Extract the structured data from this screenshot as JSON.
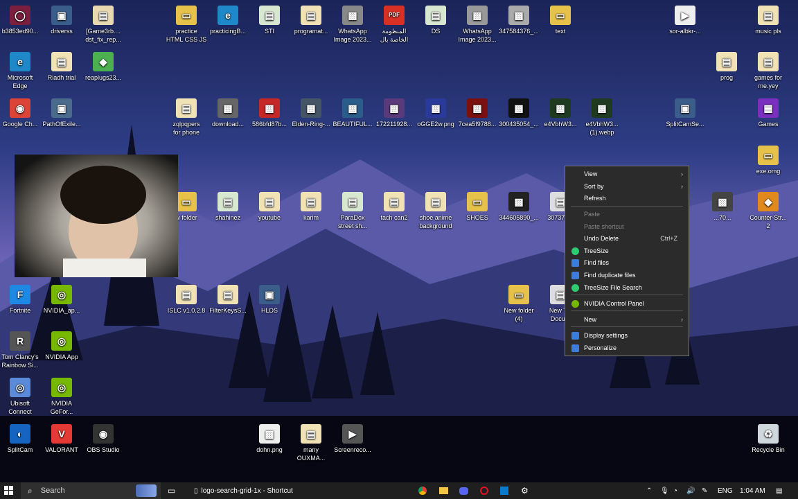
{
  "desktop": {
    "icons": [
      {
        "label": "b3853ed90...",
        "color": "#7a1f3d",
        "glyph": "◯"
      },
      {
        "label": "driverss",
        "color": "#3b5d8a",
        "glyph": "▣"
      },
      {
        "label": "[Game3rb....\ndst_fix_rep...",
        "color": "#e8d9b0",
        "glyph": "▤"
      },
      {
        "label": "practice\nHTML CSS JS",
        "color": "#e7c24a",
        "glyph": "▭"
      },
      {
        "label": "practicingB...",
        "color": "#1e88c9",
        "glyph": "e"
      },
      {
        "label": "STI",
        "color": "#d8e8d0",
        "glyph": "▤"
      },
      {
        "label": "programat...",
        "color": "#f0e2b5",
        "glyph": "▤"
      },
      {
        "label": "WhatsApp\nImage 2023...",
        "color": "#888888",
        "glyph": "▩"
      },
      {
        "label": "المنظومة\nالخاصة بال",
        "color": "#d93025",
        "glyph": "PDF"
      },
      {
        "label": "DS",
        "color": "#d8e8d0",
        "glyph": "▤"
      },
      {
        "label": "WhatsApp\nImage 2023...",
        "color": "#999999",
        "glyph": "▩"
      },
      {
        "label": "347584376_...",
        "color": "#aaaaaa",
        "glyph": "▩"
      },
      {
        "label": "text",
        "color": "#e7c24a",
        "glyph": "▭"
      },
      {
        "label": "sor-albkr-...",
        "color": "#eeeeee",
        "glyph": "▶"
      },
      {
        "label": "music pls",
        "color": "#f0e2b5",
        "glyph": "▤"
      },
      {
        "label": "Microsoft\nEdge",
        "color": "#1e88c9",
        "glyph": "e"
      },
      {
        "label": "Riadh trial",
        "color": "#f0e2b5",
        "glyph": "▤"
      },
      {
        "label": "reaplugs23...",
        "color": "#4caf50",
        "glyph": "◆"
      },
      {
        "label": "prog",
        "color": "#f0e2b5",
        "glyph": "▤"
      },
      {
        "label": "games for\nme.yey",
        "color": "#f0e2b5",
        "glyph": "▤"
      },
      {
        "label": "Google Ch...",
        "color": "#db4437",
        "glyph": "◉"
      },
      {
        "label": "PathOfExile...",
        "color": "#4a6b8c",
        "glyph": "▣"
      },
      {
        "label": "zqlpqpers\nfor phone",
        "color": "#f0e2b5",
        "glyph": "▤"
      },
      {
        "label": "download...",
        "color": "#666666",
        "glyph": "▩"
      },
      {
        "label": "586bfd87b...",
        "color": "#c62828",
        "glyph": "▩"
      },
      {
        "label": "Elden-Ring-...",
        "color": "#445566",
        "glyph": "▩"
      },
      {
        "label": "BEAUTIFUL...",
        "color": "#2a5d8a",
        "glyph": "▩"
      },
      {
        "label": "172211928...",
        "color": "#5a3a7a",
        "glyph": "▩"
      },
      {
        "label": "oGGE2w.png",
        "color": "#2a3a9a",
        "glyph": "▩"
      },
      {
        "label": "7cea5f9788...",
        "color": "#7a1010",
        "glyph": "▩"
      },
      {
        "label": "300435054_...",
        "color": "#111111",
        "glyph": "▩"
      },
      {
        "label": "e4VbhW3...",
        "color": "#203a20",
        "glyph": "▩"
      },
      {
        "label": "e4VbhW3...\n(1).webp",
        "color": "#203a20",
        "glyph": "▩"
      },
      {
        "label": "SplitCamSe...",
        "color": "#3b5d8a",
        "glyph": "▣"
      },
      {
        "label": "Games",
        "color": "#7b2fbe",
        "glyph": "▦"
      },
      {
        "label": "exe.omg",
        "color": "#e7c24a",
        "glyph": "▭"
      },
      {
        "label": "w folder",
        "color": "#e7c24a",
        "glyph": "▭"
      },
      {
        "label": "shahinez",
        "color": "#d8e8d0",
        "glyph": "▤"
      },
      {
        "label": "youtube",
        "color": "#f0e2b5",
        "glyph": "▤"
      },
      {
        "label": "karim",
        "color": "#f0e2b5",
        "glyph": "▤"
      },
      {
        "label": "ParaDox\nstreet sh...",
        "color": "#d8e8d0",
        "glyph": "▤"
      },
      {
        "label": "tach can2",
        "color": "#f0e2b5",
        "glyph": "▤"
      },
      {
        "label": "shoe anime\nbackground",
        "color": "#f0e2b5",
        "glyph": "▤"
      },
      {
        "label": "SHOES",
        "color": "#e7c24a",
        "glyph": "▭"
      },
      {
        "label": "344605890_...",
        "color": "#222222",
        "glyph": "▩"
      },
      {
        "label": "307373...",
        "color": "#dddddd",
        "glyph": "▤"
      },
      {
        "label": "...70...",
        "color": "#444444",
        "glyph": "▩"
      },
      {
        "label": "Counter-Str...\n2",
        "color": "#e08a1e",
        "glyph": "◆"
      },
      {
        "label": "Fortnite",
        "color": "#1e88e5",
        "glyph": "F"
      },
      {
        "label": "NVIDIA_ap...",
        "color": "#76b900",
        "glyph": "◎"
      },
      {
        "label": "ISLC v1.0.2.8",
        "color": "#f0e2b5",
        "glyph": "▤"
      },
      {
        "label": "FilterKeysS...",
        "color": "#f0e2b5",
        "glyph": "▤"
      },
      {
        "label": "HLDS",
        "color": "#3b5d8a",
        "glyph": "▣"
      },
      {
        "label": "New folder\n(4)",
        "color": "#e7c24a",
        "glyph": "▭"
      },
      {
        "label": "New T...\nDocu...",
        "color": "#dddddd",
        "glyph": "▤"
      },
      {
        "label": "Tom Clancy's\nRainbow Si...",
        "color": "#555555",
        "glyph": "R"
      },
      {
        "label": "NVIDIA App",
        "color": "#76b900",
        "glyph": "◎"
      },
      {
        "label": "Ubisoft\nConnect",
        "color": "#5a8ad8",
        "glyph": "◎"
      },
      {
        "label": "NVIDIA\nGeFor...",
        "color": "#76b900",
        "glyph": "◎"
      },
      {
        "label": "SplitCam",
        "color": "#1565c0",
        "glyph": "◐"
      },
      {
        "label": "VALORANT",
        "color": "#e53935",
        "glyph": "V"
      },
      {
        "label": "OBS Studio",
        "color": "#333333",
        "glyph": "◉"
      },
      {
        "label": "dohn.png",
        "color": "#eeeeee",
        "glyph": "▩"
      },
      {
        "label": "many\nOUXMA...",
        "color": "#f0e2b5",
        "glyph": "▤"
      },
      {
        "label": "Screenreco...",
        "color": "#555555",
        "glyph": "▶"
      },
      {
        "label": "Recycle Bin",
        "color": "#cfd8dc",
        "glyph": "♻"
      }
    ]
  },
  "context_menu": {
    "items": [
      {
        "label": "View",
        "submenu": true
      },
      {
        "label": "Sort by",
        "submenu": true
      },
      {
        "label": "Refresh"
      },
      {
        "label": "Paste",
        "disabled": true
      },
      {
        "label": "Paste shortcut",
        "disabled": true
      },
      {
        "label": "Undo Delete",
        "shortcut": "Ctrl+Z"
      },
      {
        "label": "TreeSize",
        "icon_color": "#2ecc71"
      },
      {
        "label": "Find files",
        "icon_color": "#3b7dd8"
      },
      {
        "label": "Find duplicate files",
        "icon_color": "#3b7dd8"
      },
      {
        "label": "TreeSize File Search",
        "icon_color": "#2ecc71"
      },
      {
        "label": "NVIDIA Control Panel",
        "icon_color": "#76b900"
      },
      {
        "label": "New",
        "submenu": true
      },
      {
        "label": "Display settings",
        "icon_color": "#3b7dd8"
      },
      {
        "label": "Personalize",
        "icon_color": "#3b7dd8"
      }
    ]
  },
  "taskbar": {
    "search_label": "Search",
    "pinned_window": "logo-search-grid-1x - Shortcut",
    "language": "ENG",
    "time": "1:04 AM"
  },
  "colors": {
    "menu_bg": "#2b2b2b",
    "taskbar_bg": "#1f1f1f"
  }
}
